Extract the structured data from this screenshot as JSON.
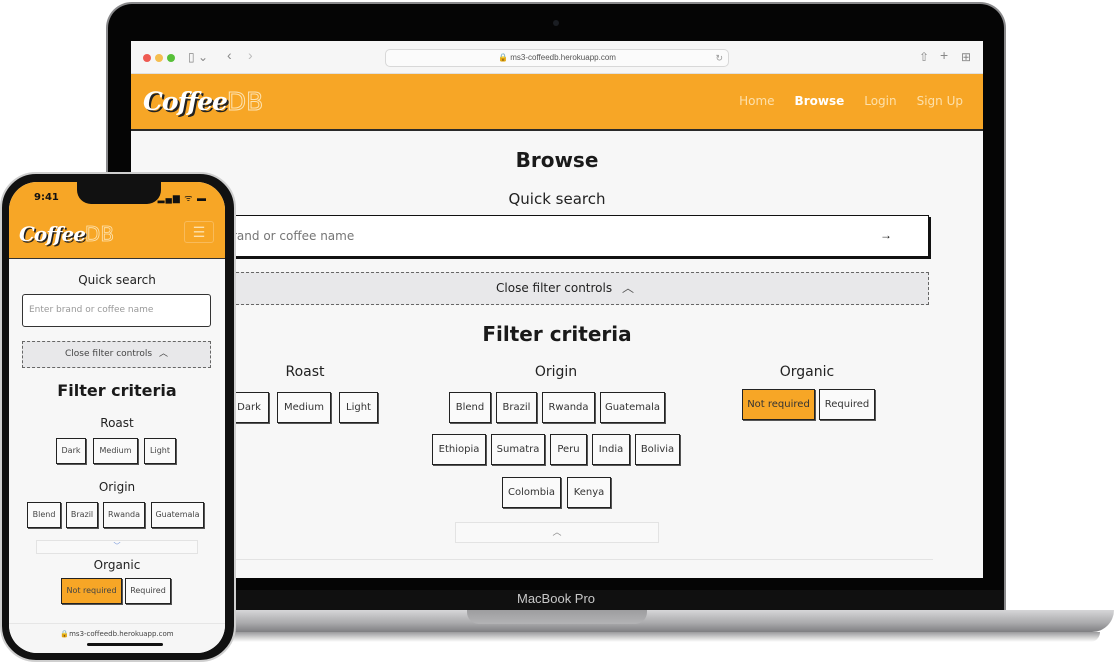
{
  "device_label": "MacBook Pro",
  "browser": {
    "url": "ms3-coffeedb.herokuapp.com",
    "icons": [
      "sidebar-icon",
      "back-icon",
      "forward-icon",
      "reload-icon",
      "share-icon",
      "new-tab-icon",
      "tab-overview-icon"
    ]
  },
  "site": {
    "logo_main": "Coffee",
    "logo_db": "DB",
    "nav": [
      {
        "label": "Home",
        "active": false
      },
      {
        "label": "Browse",
        "active": true
      },
      {
        "label": "Login",
        "active": false
      },
      {
        "label": "Sign Up",
        "active": false
      }
    ],
    "accent_color": "#f7a626"
  },
  "page": {
    "title": "Browse",
    "quick_search_label": "Quick search",
    "search_placeholder": "Enter brand or coffee name",
    "search_visible_text": "rand or coffee name",
    "search_submit_icon": "→",
    "filter_toggle_label": "Close filter controls",
    "filter_toggle_icon": "︿",
    "filter_title": "Filter criteria",
    "roast": {
      "label": "Roast",
      "options": [
        "Dark",
        "Medium",
        "Light"
      ]
    },
    "origin": {
      "label": "Origin",
      "options": [
        "Blend",
        "Brazil",
        "Rwanda",
        "Guatemala",
        "Ethiopia",
        "Sumatra",
        "Peru",
        "India",
        "Bolivia",
        "Colombia",
        "Kenya"
      ],
      "collapse_icon": "︿"
    },
    "organic": {
      "label": "Organic",
      "options": [
        {
          "label": "Not required",
          "selected": true
        },
        {
          "label": "Required",
          "selected": false
        }
      ]
    }
  },
  "phone": {
    "time": "9:41",
    "status_icons": "▂▄▆ ᯤ ▬",
    "menu_icon": "☰",
    "origin_visible_options": [
      "Blend",
      "Brazil",
      "Rwanda",
      "Guatemala"
    ],
    "expand_icon": "﹀",
    "footer_url": "🔒ms3-coffeedb.herokuapp.com"
  }
}
